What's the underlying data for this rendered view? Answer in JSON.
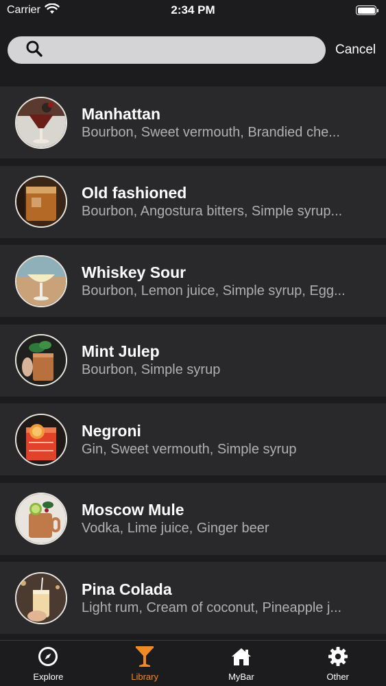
{
  "status_bar": {
    "carrier": "Carrier",
    "time": "2:34 PM"
  },
  "search": {
    "value": "",
    "placeholder": "",
    "cancel_label": "Cancel"
  },
  "cocktails": [
    {
      "name": "Manhattan",
      "ingredients": "Bourbon, Sweet vermouth, Brandied che..."
    },
    {
      "name": "Old fashioned",
      "ingredients": "Bourbon, Angostura bitters, Simple syrup..."
    },
    {
      "name": "Whiskey Sour",
      "ingredients": "Bourbon, Lemon juice, Simple syrup, Egg..."
    },
    {
      "name": "Mint Julep",
      "ingredients": "Bourbon, Simple syrup"
    },
    {
      "name": "Negroni",
      "ingredients": "Gin, Sweet vermouth, Simple syrup"
    },
    {
      "name": "Moscow Mule",
      "ingredients": "Vodka, Lime juice, Ginger beer"
    },
    {
      "name": "Pina Colada",
      "ingredients": "Light rum, Cream of coconut, Pineapple j..."
    }
  ],
  "tabs": [
    {
      "label": "Explore",
      "icon": "compass-icon",
      "active": false
    },
    {
      "label": "Library",
      "icon": "cocktail-glass-icon",
      "active": true
    },
    {
      "label": "MyBar",
      "icon": "home-icon",
      "active": false
    },
    {
      "label": "Other",
      "icon": "gear-icon",
      "active": false
    }
  ],
  "colors": {
    "background": "#1c1c1e",
    "row_background": "#29292b",
    "accent": "#f08a24",
    "subtitle": "#b0b0b3",
    "search_field": "#d4d4d6"
  }
}
